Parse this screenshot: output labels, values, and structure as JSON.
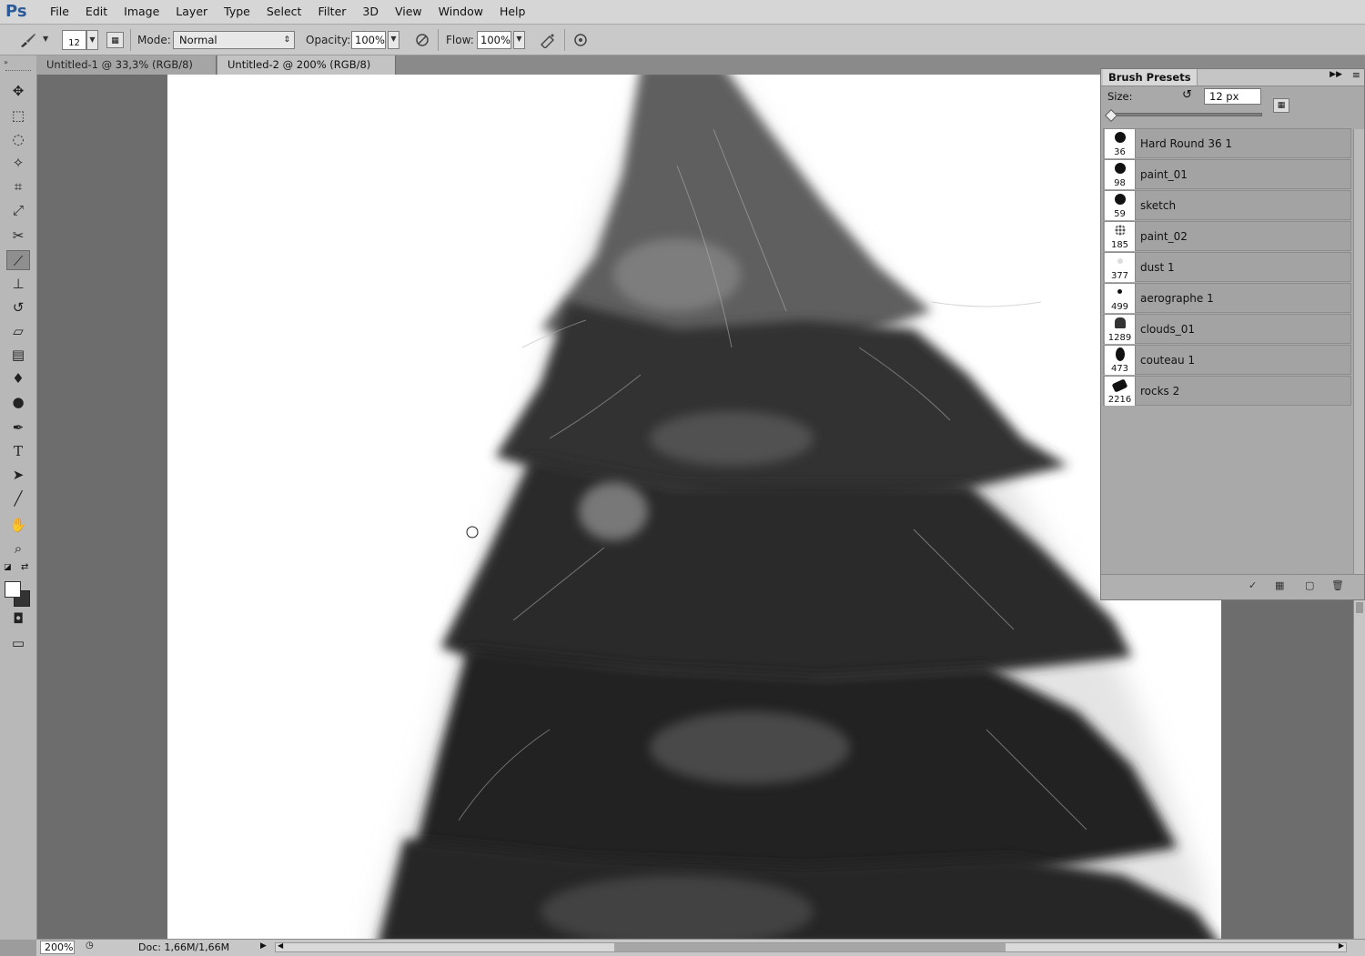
{
  "app": {
    "logo": "Ps"
  },
  "menu": [
    "File",
    "Edit",
    "Image",
    "Layer",
    "Type",
    "Select",
    "Filter",
    "3D",
    "View",
    "Window",
    "Help"
  ],
  "options": {
    "brush_size": "12",
    "mode_label": "Mode:",
    "mode_value": "Normal",
    "opacity_label": "Opacity:",
    "opacity_value": "100%",
    "flow_label": "Flow:",
    "flow_value": "100%"
  },
  "tabs": [
    {
      "label": "Untitled-1 @ 33,3% (RGB/8) *",
      "close": "×",
      "active": false
    },
    {
      "label": "Untitled-2 @ 200% (RGB/8) *",
      "close": "×",
      "active": true
    }
  ],
  "brush_panel": {
    "title": "Brush Presets",
    "size_label": "Size:",
    "size_value": "12 px",
    "presets": [
      {
        "size": "36",
        "name": "Hard Round 36 1"
      },
      {
        "size": "98",
        "name": "paint_01"
      },
      {
        "size": "59",
        "name": "sketch"
      },
      {
        "size": "185",
        "name": "paint_02"
      },
      {
        "size": "377",
        "name": "dust 1"
      },
      {
        "size": "499",
        "name": "aerographe 1"
      },
      {
        "size": "1289",
        "name": "clouds_01"
      },
      {
        "size": "473",
        "name": "couteau 1"
      },
      {
        "size": "2216",
        "name": "rocks 2"
      }
    ]
  },
  "status": {
    "zoom": "200%",
    "doc_info": "Doc: 1,66M/1,66M"
  },
  "colors": {
    "foreground": "#ffffff",
    "background": "#333333"
  }
}
